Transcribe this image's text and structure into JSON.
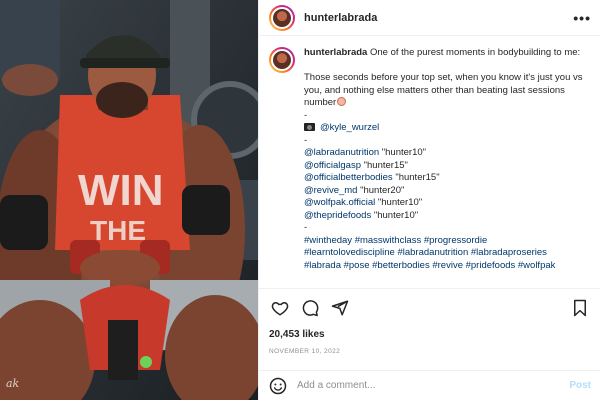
{
  "post": {
    "photo_signature": "ak",
    "header_username": "hunterlabrada",
    "more_icon": "ellipsis-icon",
    "caption": {
      "username": "hunterlabrada",
      "text": "One of the purest moments in bodybuilding to me:",
      "paragraph": "Those seconds before your top set, when you know it's just you vs you, and nothing else matters other than beating last sessions number",
      "dash1": "-",
      "photo_credit": "@kyle_wurzel",
      "dash2": "-",
      "codes": [
        {
          "handle": "@labradanutrition",
          "code": "\"hunter10\""
        },
        {
          "handle": "@officialgasp",
          "code": "\"hunter15\""
        },
        {
          "handle": "@officialbetterbodies",
          "code": "\"hunter15\""
        },
        {
          "handle": "@revive_md",
          "code": "\"hunter20\""
        },
        {
          "handle": "@wolfpak.official",
          "code": "\"hunter10\""
        },
        {
          "handle": "@thepridefoods",
          "code": "\"hunter10\""
        }
      ],
      "dash3": "-",
      "hashtags1": "#wintheday #masswithclass #progressordie",
      "hashtags2": "#learntolovediscipline #labradanutrition #labradaproseries",
      "hashtags3": "#labrada #pose #betterbodies #revive #pridefoods #wolfpak"
    },
    "likes": "20,453 likes",
    "date": "NOVEMBER 10, 2022",
    "comment_placeholder": "Add a comment...",
    "post_button": "Post",
    "colors": {
      "link": "#00376b",
      "post_button": "#b2dffc",
      "muted": "#8e8e8e",
      "tank_top": "#d7462f"
    }
  }
}
